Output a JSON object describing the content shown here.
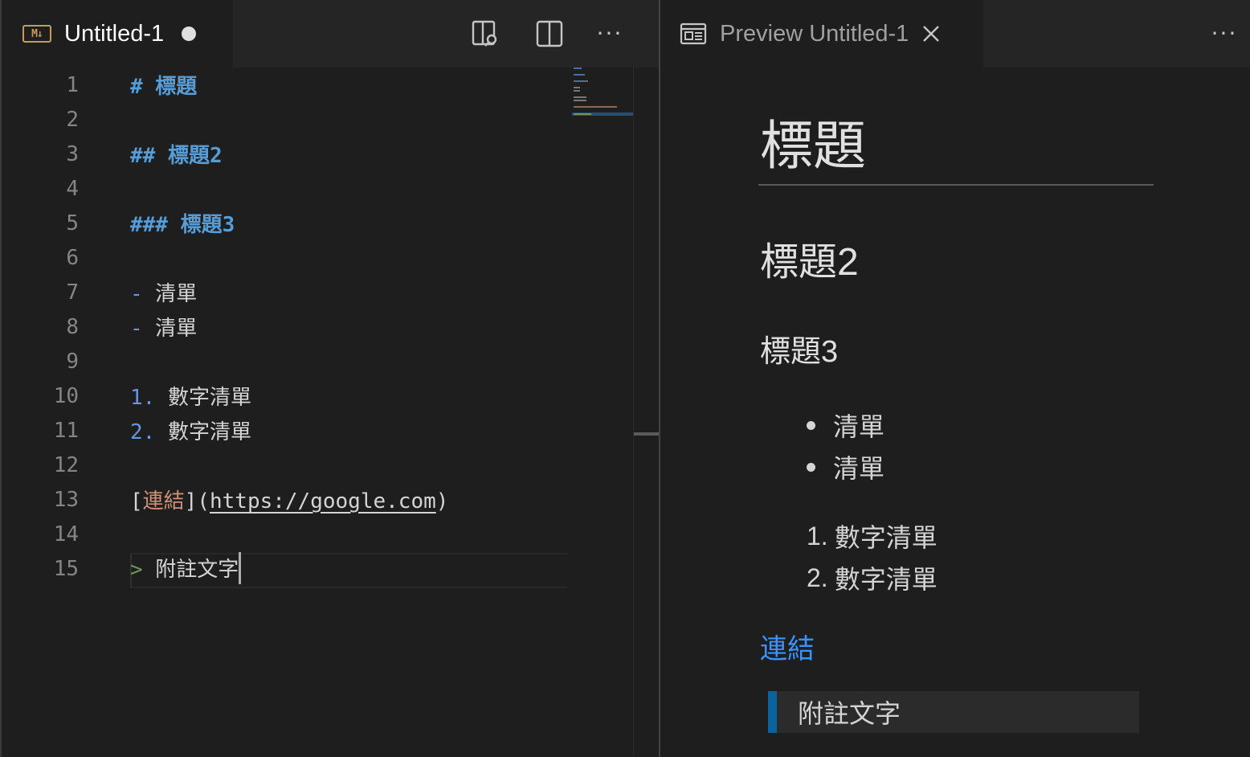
{
  "editor": {
    "tab": {
      "title": "Untitled-1",
      "icon": "markdown-icon",
      "icon_text": "M↓"
    },
    "toolbar": {
      "open_preview_icon": "open-preview-to-side-icon",
      "split_icon": "split-editor-icon",
      "more_label": "···"
    },
    "lines": [
      {
        "num": "1",
        "parts": [
          {
            "cls": "tok-head",
            "text": "# 標題"
          }
        ]
      },
      {
        "num": "2",
        "parts": []
      },
      {
        "num": "3",
        "parts": [
          {
            "cls": "tok-head",
            "text": "## 標題2"
          }
        ]
      },
      {
        "num": "4",
        "parts": []
      },
      {
        "num": "5",
        "parts": [
          {
            "cls": "tok-head",
            "text": "### 標題3"
          }
        ]
      },
      {
        "num": "6",
        "parts": []
      },
      {
        "num": "7",
        "parts": [
          {
            "cls": "tok-bullet",
            "text": "-"
          },
          {
            "cls": "",
            "text": " 清單"
          }
        ]
      },
      {
        "num": "8",
        "parts": [
          {
            "cls": "tok-bullet",
            "text": "-"
          },
          {
            "cls": "",
            "text": " 清單"
          }
        ]
      },
      {
        "num": "9",
        "parts": []
      },
      {
        "num": "10",
        "parts": [
          {
            "cls": "tok-bullet",
            "text": "1."
          },
          {
            "cls": "",
            "text": " 數字清單"
          }
        ]
      },
      {
        "num": "11",
        "parts": [
          {
            "cls": "tok-bullet",
            "text": "2."
          },
          {
            "cls": "",
            "text": " 數字清單"
          }
        ]
      },
      {
        "num": "12",
        "parts": []
      },
      {
        "num": "13",
        "parts": [
          {
            "cls": "",
            "text": "["
          },
          {
            "cls": "tok-link",
            "text": "連結"
          },
          {
            "cls": "",
            "text": "]("
          },
          {
            "cls": "tok-url",
            "text": "https://google.com"
          },
          {
            "cls": "",
            "text": ")"
          }
        ]
      },
      {
        "num": "14",
        "parts": []
      },
      {
        "num": "15",
        "parts": [
          {
            "cls": "tok-quote",
            "text": ">"
          },
          {
            "cls": "",
            "text": " 附註文字"
          }
        ]
      }
    ]
  },
  "preview": {
    "tab": {
      "title": "Preview Untitled-1",
      "icon": "preview-icon",
      "close_icon": "close-icon"
    },
    "more_label": "···",
    "h1": "標題",
    "h2": "標題2",
    "h3": "標題3",
    "bullets": [
      "清單",
      "清單"
    ],
    "numbered": [
      {
        "marker": "1.",
        "text": "數字清單"
      },
      {
        "marker": "2.",
        "text": "數字清單"
      }
    ],
    "link": "連結",
    "blockquote": "附註文字"
  },
  "colors": {
    "heading_token": "#569cd6",
    "link_preview": "#3794ff",
    "quote_bar": "#0a639b",
    "md_icon": "#c59a5a"
  }
}
